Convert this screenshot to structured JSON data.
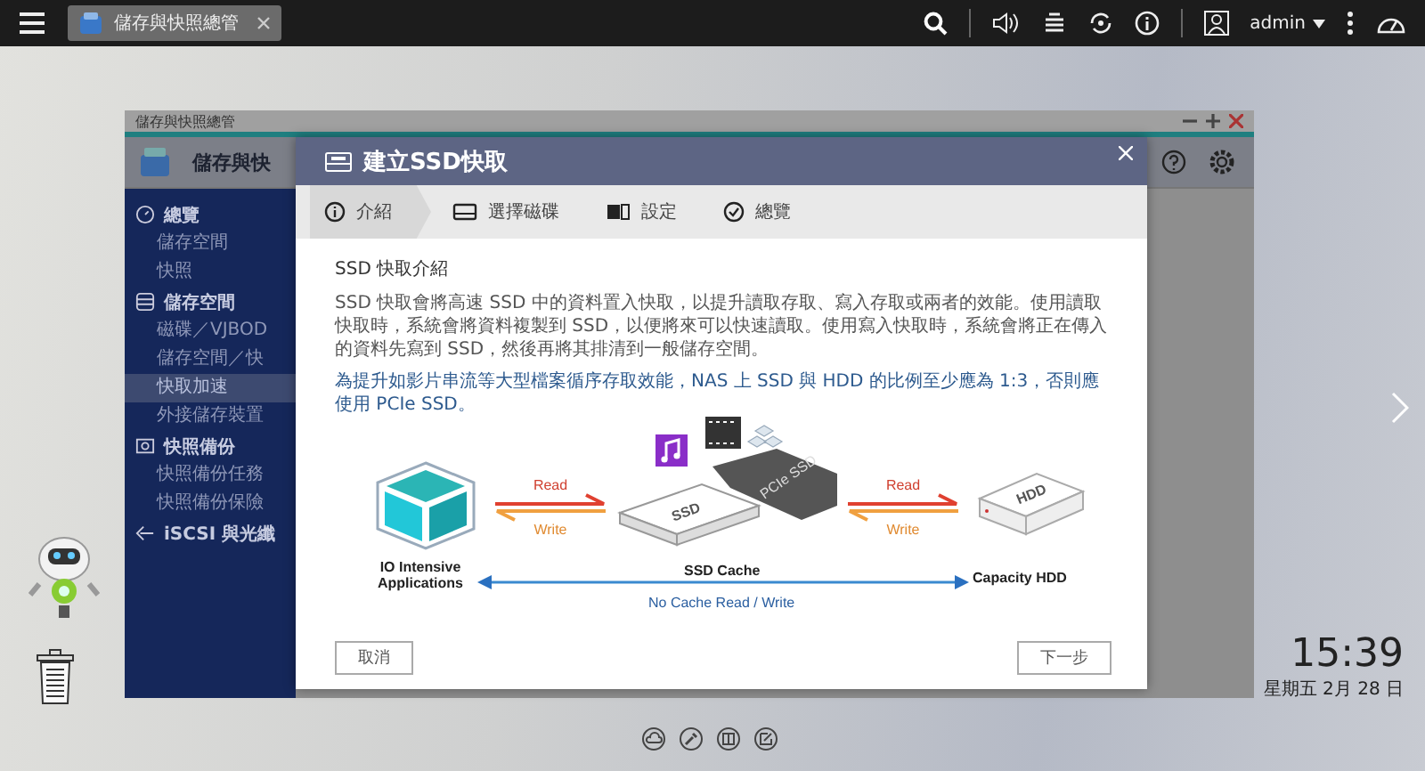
{
  "taskbar": {
    "tab_title": "儲存與快照總管",
    "user": "admin"
  },
  "app_window": {
    "title": "儲存與快照總管",
    "header_title": "儲存與快",
    "sidebar": [
      {
        "label": "總覽",
        "children": [
          {
            "label": "儲存空間",
            "selected": false
          },
          {
            "label": "快照",
            "selected": false
          }
        ]
      },
      {
        "label": "儲存空間",
        "children": [
          {
            "label": "磁碟／VJBOD",
            "selected": false
          },
          {
            "label": "儲存空間／快",
            "selected": false
          },
          {
            "label": "快取加速",
            "selected": true
          },
          {
            "label": "外接儲存裝置",
            "selected": false
          }
        ]
      },
      {
        "label": "快照備份",
        "children": [
          {
            "label": "快照備份任務",
            "selected": false
          },
          {
            "label": "快照備份保險",
            "selected": false
          }
        ]
      },
      {
        "label": "iSCSI 與光纖"
      }
    ]
  },
  "dialog": {
    "title": "建立SSD快取",
    "steps": [
      {
        "label": "介紹",
        "selected": true
      },
      {
        "label": "選擇磁碟",
        "selected": false
      },
      {
        "label": "設定",
        "selected": false
      },
      {
        "label": "總覽",
        "selected": false
      }
    ],
    "heading": "SSD 快取介紹",
    "description": "SSD 快取會將高速 SSD 中的資料置入快取，以提升讀取存取、寫入存取或兩者的效能。使用讀取快取時，系統會將資料複製到 SSD，以便將來可以快速讀取。使用寫入快取時，系統會將正在傳入的資料先寫到 SSD，然後再將其排清到一般儲存空間。",
    "note": "為提升如影片串流等大型檔案循序存取效能，NAS 上 SSD 與 HDD 的比例至少應為 1:3，否則應使用 PCIe SSD。",
    "diagram": {
      "app_label": "IO Intensive Applications",
      "left_read_label": "Read",
      "left_write_label": "Write",
      "right_read_label": "Read",
      "right_write_label": "Write",
      "ssd_text": "SSD",
      "pcie_text": "PCIe SSD",
      "hdd_text": "HDD",
      "cache_label": "SSD Cache",
      "hdd_label": "Capacity HDD",
      "bypass_label": "No Cache Read / Write"
    },
    "cancel_button": "取消",
    "next_button": "下一步"
  },
  "desktop": {
    "time": "15:39",
    "date": "星期五 2月 28 日"
  }
}
